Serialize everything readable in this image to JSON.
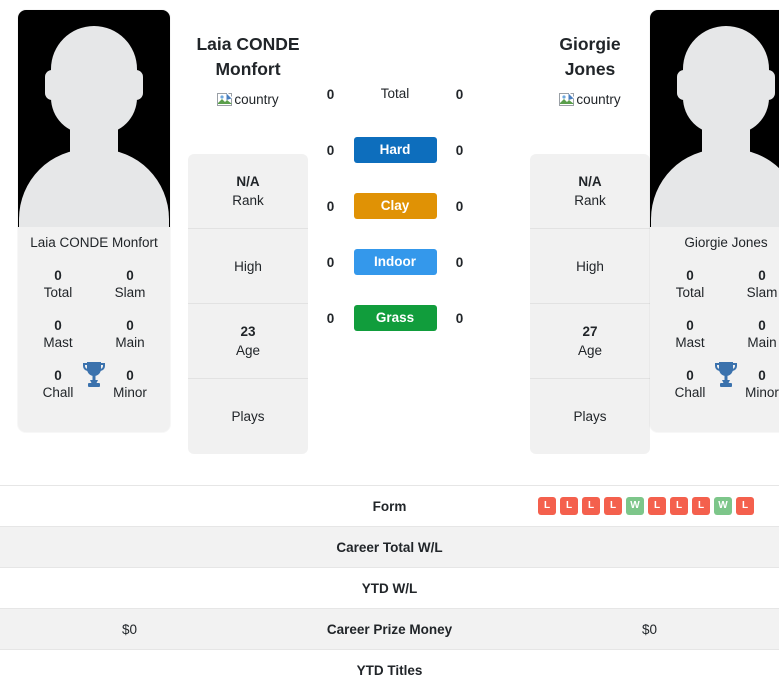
{
  "players": [
    {
      "side": "left",
      "display_name": "Laia CONDE Monfort",
      "heading_line1": "Laia CONDE",
      "heading_line2": "Monfort",
      "country_alt": "country",
      "titles": [
        {
          "value": "0",
          "label": "Total"
        },
        {
          "value": "0",
          "label": "Slam"
        },
        {
          "value": "0",
          "label": "Mast"
        },
        {
          "value": "0",
          "label": "Main"
        },
        {
          "value": "0",
          "label": "Chall"
        },
        {
          "value": "0",
          "label": "Minor"
        }
      ],
      "info": [
        {
          "value": "N/A",
          "label": "Rank"
        },
        {
          "value": "",
          "label": "High"
        },
        {
          "value": "23",
          "label": "Age"
        },
        {
          "value": "",
          "label": "Plays"
        }
      ],
      "surface_counts": [
        "0",
        "0",
        "0",
        "0",
        "0"
      ],
      "career_prize_money": "$0",
      "career_total_wl": "",
      "ytd_wl": "",
      "ytd_titles": "",
      "form": []
    },
    {
      "side": "right",
      "display_name": "Giorgie Jones",
      "heading_line1": "Giorgie",
      "heading_line2": "Jones",
      "country_alt": "country",
      "titles": [
        {
          "value": "0",
          "label": "Total"
        },
        {
          "value": "0",
          "label": "Slam"
        },
        {
          "value": "0",
          "label": "Mast"
        },
        {
          "value": "0",
          "label": "Main"
        },
        {
          "value": "0",
          "label": "Chall"
        },
        {
          "value": "0",
          "label": "Minor"
        }
      ],
      "info": [
        {
          "value": "N/A",
          "label": "Rank"
        },
        {
          "value": "",
          "label": "High"
        },
        {
          "value": "27",
          "label": "Age"
        },
        {
          "value": "",
          "label": "Plays"
        }
      ],
      "surface_counts": [
        "0",
        "0",
        "0",
        "0",
        "0"
      ],
      "career_prize_money": "$0",
      "career_total_wl": "",
      "ytd_wl": "",
      "ytd_titles": "",
      "form": [
        "L",
        "L",
        "L",
        "L",
        "W",
        "L",
        "L",
        "L",
        "W",
        "L"
      ]
    }
  ],
  "surfaces": [
    {
      "label": "Total",
      "color": "transparent",
      "text_color": "#212529"
    },
    {
      "label": "Hard",
      "color": "#0d6ebd",
      "text_color": "#ffffff"
    },
    {
      "label": "Clay",
      "color": "#e09205",
      "text_color": "#ffffff"
    },
    {
      "label": "Indoor",
      "color": "#3498eb",
      "text_color": "#ffffff"
    },
    {
      "label": "Grass",
      "color": "#119d3c",
      "text_color": "#ffffff"
    }
  ],
  "table_rows": [
    {
      "key": "form",
      "label": "Form",
      "striped": false
    },
    {
      "key": "career_total_wl",
      "label": "Career Total W/L",
      "striped": true
    },
    {
      "key": "ytd_wl",
      "label": "YTD W/L",
      "striped": false
    },
    {
      "key": "career_prize_money",
      "label": "Career Prize Money",
      "striped": true
    },
    {
      "key": "ytd_titles",
      "label": "YTD Titles",
      "striped": false
    }
  ],
  "form_colors": {
    "W": "#7dc68a",
    "L": "#f4604d"
  },
  "theme": {
    "card_bg": "#f1f1f1",
    "photo_bg": "#000000",
    "silhouette": "#e6e7e8",
    "trophy": "#3b72ad",
    "stripe_bg": "#f2f2f2",
    "border": "#e6e6e6"
  }
}
